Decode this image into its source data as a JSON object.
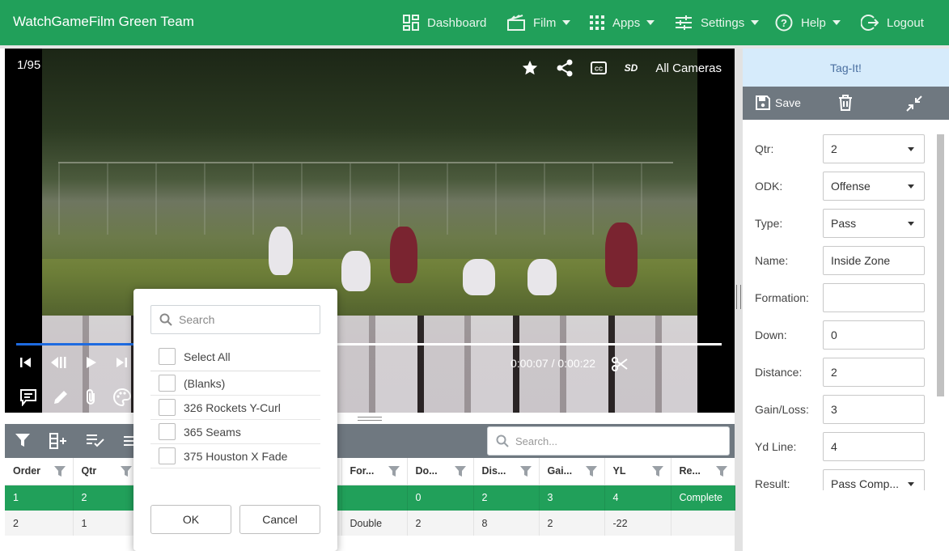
{
  "app": {
    "title": "WatchGameFilm Green Team"
  },
  "nav": [
    {
      "label": "Dashboard",
      "icon": "dashboard-icon",
      "caret": false
    },
    {
      "label": "Film",
      "icon": "film-icon",
      "caret": true
    },
    {
      "label": "Apps",
      "icon": "apps-grid-icon",
      "caret": true
    },
    {
      "label": "Settings",
      "icon": "sliders-icon",
      "caret": true
    },
    {
      "label": "Help",
      "icon": "help-icon",
      "caret": true
    },
    {
      "label": "Logout",
      "icon": "logout-icon",
      "caret": false
    }
  ],
  "video": {
    "counter": "1/95",
    "quality": "SD",
    "cameras": "All Cameras",
    "time": "0:00:07 / 0:00:22",
    "progress": 0.32
  },
  "grid": {
    "search_placeholder": "Search...",
    "columns": [
      "Order",
      "Qtr",
      "",
      "",
      "For...",
      "Do...",
      "Dis...",
      "Gai...",
      "YL",
      "Re..."
    ],
    "rows": [
      [
        "1",
        "2",
        "",
        "",
        "",
        "0",
        "2",
        "3",
        "4",
        "Complete"
      ],
      [
        "2",
        "1",
        "",
        "",
        "Double",
        "2",
        "8",
        "2",
        "-22",
        ""
      ]
    ]
  },
  "filter_popup": {
    "search_placeholder": "Search",
    "select_all": "Select All",
    "items": [
      "(Blanks)",
      "326 Rockets Y-Curl",
      "365 Seams",
      "375 Houston X Fade"
    ],
    "ok": "OK",
    "cancel": "Cancel"
  },
  "tag_panel": {
    "title": "Tag-It!",
    "save": "Save",
    "fields": [
      {
        "label": "Qtr:",
        "value": "2",
        "dropdown": true
      },
      {
        "label": "ODK:",
        "value": "Offense",
        "dropdown": true
      },
      {
        "label": "Type:",
        "value": "Pass",
        "dropdown": true
      },
      {
        "label": "Name:",
        "value": "Inside Zone",
        "dropdown": false
      },
      {
        "label": "Formation:",
        "value": "",
        "dropdown": false
      },
      {
        "label": "Down:",
        "value": "0",
        "dropdown": false
      },
      {
        "label": "Distance:",
        "value": "2",
        "dropdown": false
      },
      {
        "label": "Gain/Loss:",
        "value": "3",
        "dropdown": false
      },
      {
        "label": "Yd Line:",
        "value": "4",
        "dropdown": false
      },
      {
        "label": "Result:",
        "value": "Pass Comp...",
        "dropdown": true
      }
    ]
  },
  "colors": {
    "brand": "#21a05a",
    "toolbar": "#6f7880",
    "tag_header": "#d6ebfb",
    "progress": "#1e6be0"
  }
}
